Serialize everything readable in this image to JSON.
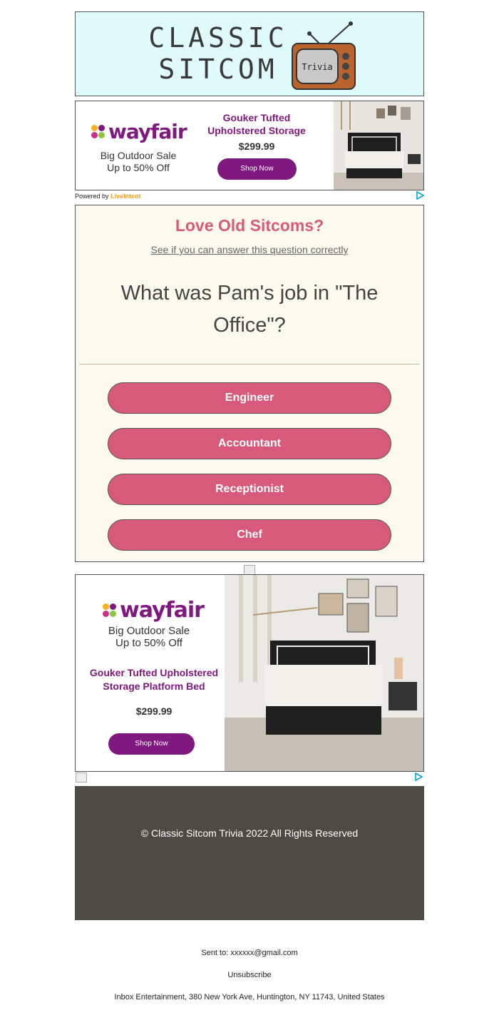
{
  "header": {
    "logo_line1": "CLASSIC",
    "logo_line2": "SITCOM",
    "tv_label": "Trivia"
  },
  "ad_top": {
    "brand": "wayfair",
    "sale_line1": "Big Outdoor Sale",
    "sale_line2": "Up to 50% Off",
    "product_line1": "Gouker Tufted",
    "product_line2": "Upholstered Storage",
    "price": "$299.99",
    "cta": "Shop Now",
    "powered_prefix": "Powered by",
    "powered_brand": "LiveIntent"
  },
  "trivia": {
    "title": "Love Old Sitcoms?",
    "subtitle": "See if you can answer this question correctly",
    "question": "What was Pam's job in \"The Office\"?",
    "answers": [
      "Engineer",
      "Accountant",
      "Receptionist",
      "Chef"
    ]
  },
  "ad_bottom": {
    "brand": "wayfair",
    "sale_line1": "Big Outdoor Sale",
    "sale_line2": "Up to 50% Off",
    "product_line1": "Gouker Tufted Upholstered",
    "product_line2": "Storage Platform Bed",
    "price": "$299.99",
    "cta": "Shop Now"
  },
  "footer": {
    "copyright": "© Classic Sitcom Trivia 2022 All Rights Reserved",
    "sent_to": "Sent to: xxxxxx@gmail.com",
    "unsubscribe": "Unsubscribe",
    "address": "Inbox Entertainment, 380 New York Ave, Huntington, NY 11743, United States"
  },
  "colors": {
    "header_bg": "#e0fcfa",
    "brand_purple": "#7f187f",
    "accent_pink": "#d85a7b",
    "card_bg": "#fcfaef",
    "footer_bg": "#4e4b44"
  }
}
